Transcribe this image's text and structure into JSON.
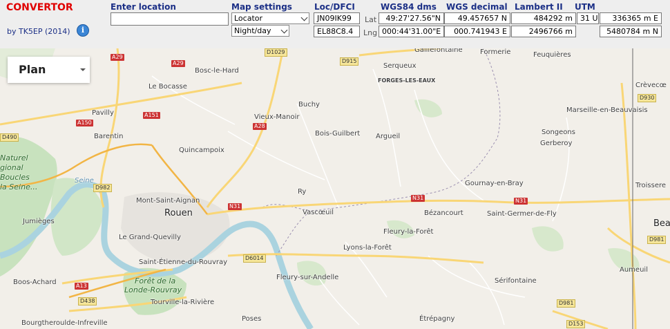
{
  "app": {
    "title": "CONVERTOR",
    "author": "by TK5EP (2014)"
  },
  "icons": {
    "info": "info-icon"
  },
  "location": {
    "label": "Enter location",
    "value": ""
  },
  "map_settings": {
    "label": "Map settings",
    "mode": "Locator",
    "theme": "Night/day"
  },
  "loc_dfci": {
    "label": "Loc/DFCI",
    "lat": "JN09IK99",
    "lng": "EL88C8.4"
  },
  "row_labels": {
    "lat": "Lat",
    "lng": "Lng"
  },
  "wgs84_dms": {
    "label": "WGS84 dms",
    "lat": "49:27'27.56\"N",
    "lng": "000:44'31.00\"E"
  },
  "wgs_decimal": {
    "label": "WGS decimal",
    "lat": "49.457657 N",
    "lng": "000.741943 E"
  },
  "lambert": {
    "label": "Lambert II",
    "lat": "484292 m",
    "lng": "2496766 m"
  },
  "utm": {
    "label": "UTM",
    "zone": "31 U",
    "e": "336365 m E",
    "n": "5480784 m N"
  },
  "map": {
    "view": "Plan",
    "places": [
      "Bosc-le-Hard",
      "Le Bocasse",
      "Pavilly",
      "Barentin",
      "Vieux-Manoir",
      "Quincampoix",
      "Buchy",
      "Bois-Guilbert",
      "Argueil",
      "Serqueux",
      "Gaillefontaine",
      "Formerie",
      "Feuquières",
      "Crèvecœ",
      "Marseille-en-Beauvaisis",
      "Songeons",
      "Gerberoy",
      "Troissere",
      "Gournay-en-Bray",
      "Saint-Germer-de-Fly",
      "Bézancourt",
      "Ry",
      "Vascœuil",
      "Fleury-la-Forêt",
      "Lyons-la-Forêt",
      "Mont-Saint-Aignan",
      "Rouen",
      "Le Grand-Quevilly",
      "Saint-Étienne-du-Rouvray",
      "Jumièges",
      "Bosc-Le-Hard",
      "Boos-Achard",
      "Forêt de la",
      "Londe-Rouvray",
      "Tourville-la-Rivière",
      "Fleury-sur-Andelle",
      "Sérifontaine",
      "Aumeuil",
      "Bourgtheroulde-Infreville",
      "Poses",
      "Étrépagny",
      "Bea"
    ],
    "extra": {
      "forges": "FORGES-LES-EAUX",
      "seine": "Seine",
      "regional": [
        "Naturel",
        "gional",
        "Boucles",
        "la Seine..."
      ]
    },
    "roads": [
      "A29",
      "A29",
      "D1029",
      "D915",
      "A151",
      "A150",
      "A28",
      "D490",
      "D982",
      "N31",
      "N31",
      "N31",
      "D6014",
      "A13",
      "D438",
      "D930",
      "D981",
      "D981",
      "D153"
    ]
  }
}
